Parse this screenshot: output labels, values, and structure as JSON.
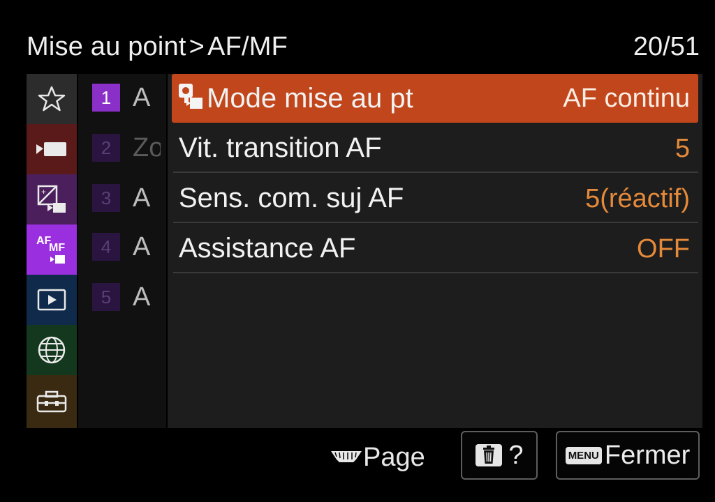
{
  "header": {
    "breadcrumb_parent": "Mise au point",
    "breadcrumb_separator": ">",
    "breadcrumb_current": "AF/MF",
    "page_counter": "20/51"
  },
  "category_tabs": [
    {
      "name": "favorites",
      "icon": "star-icon",
      "bg": "#2c2c2c",
      "active": false
    },
    {
      "name": "shooting",
      "icon": "camera-video-icon",
      "bg": "#5a1a1a",
      "active": false
    },
    {
      "name": "exposure-color",
      "icon": "exposure-icon",
      "bg": "#4a1f5c",
      "active": false
    },
    {
      "name": "af-mf",
      "icon": "af-mf-icon",
      "bg": "#9a2fe0",
      "active": true,
      "line1": "AF",
      "line2": "MF"
    },
    {
      "name": "playback",
      "icon": "playback-icon",
      "bg": "#0f2a4a",
      "active": false
    },
    {
      "name": "network",
      "icon": "globe-icon",
      "bg": "#14381e",
      "active": false
    },
    {
      "name": "setup",
      "icon": "toolbox-icon",
      "bg": "#3a2a12",
      "active": false
    }
  ],
  "subpages": [
    {
      "num": "1",
      "text": "A",
      "active": true
    },
    {
      "num": "2",
      "text": "Zo",
      "active": false
    },
    {
      "num": "3",
      "text": "A",
      "active": false
    },
    {
      "num": "4",
      "text": "A",
      "active": false
    },
    {
      "num": "5",
      "text": "A",
      "active": false
    }
  ],
  "menu_rows": [
    {
      "label": "Mode mise au pt",
      "value": "AF continu",
      "selected": true
    },
    {
      "label": "Vit. transition AF",
      "value": "5",
      "selected": false
    },
    {
      "label": "Sens. com. suj AF",
      "value": "5(réactif)",
      "selected": false
    },
    {
      "label": "Assistance AF",
      "value": "OFF",
      "selected": false
    }
  ],
  "footer": {
    "page_label": "Page",
    "help_label": "?",
    "menu_badge": "MENU",
    "close_label": "Fermer"
  },
  "colors": {
    "selected_row": "#c2461b",
    "value_text": "#e58a3a",
    "active_tab": "#9a2fe0"
  }
}
